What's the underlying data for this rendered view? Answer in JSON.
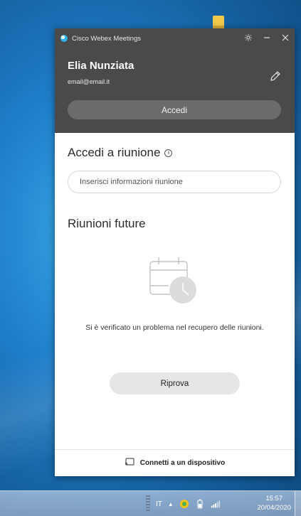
{
  "window": {
    "app_title": "Cisco Webex Meetings",
    "icons": [
      "settings-icon",
      "minimize-icon",
      "close-icon"
    ]
  },
  "user": {
    "name": "Elia Nunziata",
    "email": "email@email.it",
    "signin_label": "Accedi"
  },
  "join": {
    "title": "Accedi a riunione",
    "placeholder": "Inserisci informazioni riunione"
  },
  "upcoming": {
    "title": "Riunioni future",
    "error_message": "Si è verificato un problema nel recupero delle riunioni.",
    "retry_label": "Riprova"
  },
  "footer": {
    "connect_label": "Connetti a un dispositivo"
  },
  "taskbar": {
    "language": "IT",
    "time": "15:57",
    "date": "20/04/2020"
  },
  "colors": {
    "header_bg": "#4a4a4a",
    "button_bg": "#6b6b6b",
    "retry_bg": "#e6e6e6",
    "accent": "#2db3e8"
  }
}
